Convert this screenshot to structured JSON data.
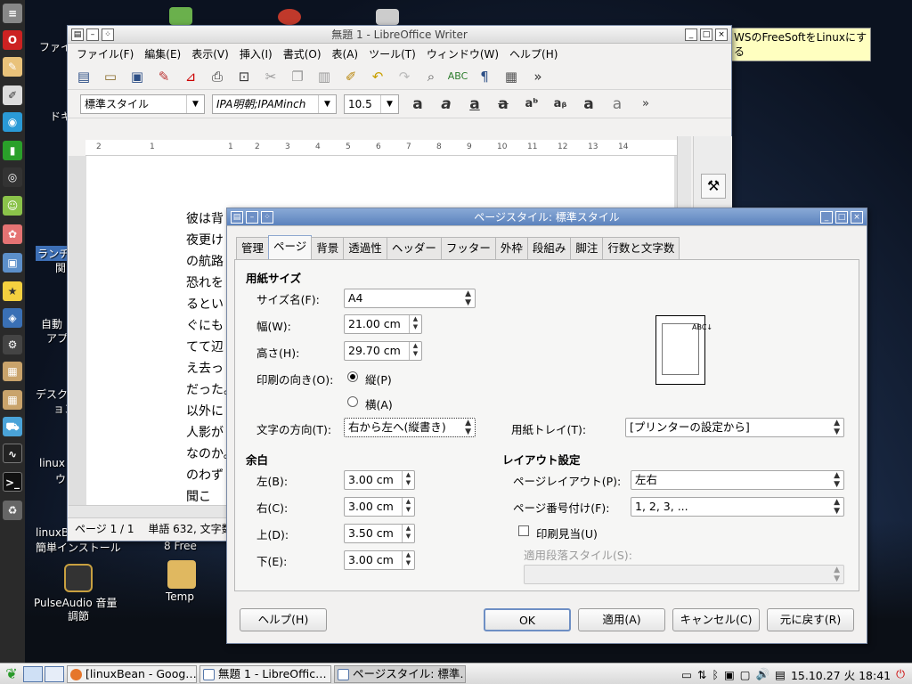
{
  "tooltip": {
    "text": "WSのFreeSoftをLinuxにする"
  },
  "desktop": {
    "labels": [
      "ファイ",
      "ドキ",
      "ランチ",
      "関",
      "自動",
      "アプ",
      "デスク",
      "ョン",
      "linux",
      "ウ",
      "linuxB",
      "簡単インストール",
      "8 Free",
      "PulseAudio 音量",
      "調節",
      "Temp"
    ]
  },
  "writer": {
    "title": "無題 1 - LibreOffice Writer",
    "menu": [
      "ファイル(F)",
      "編集(E)",
      "表示(V)",
      "挿入(I)",
      "書式(O)",
      "表(A)",
      "ツール(T)",
      "ウィンドウ(W)",
      "ヘルプ(H)"
    ],
    "paragraph_style": "標準スタイル",
    "font_name": "IPA明朝;IPAMinch",
    "font_size": "10.5",
    "ruler_ticks": [
      "2",
      "1",
      "1",
      "2",
      "3",
      "4",
      "5",
      "6",
      "7",
      "8",
      "9",
      "10",
      "11",
      "12",
      "13",
      "14"
    ],
    "doc_lines": [
      "彼は背",
      "夜更け",
      "の航路",
      "恐れを",
      "るとい",
      "ぐにも",
      "てて辺",
      "え去っ",
      "だった。",
      "以外に",
      "人影が",
      "なのか。",
      "のわず",
      "聞こ"
    ],
    "status": "ページ 1 / 1　 単語 632, 文字数"
  },
  "dialog": {
    "title": "ページスタイル: 標準スタイル",
    "tabs": [
      "管理",
      "ページ",
      "背景",
      "透過性",
      "ヘッダー",
      "フッター",
      "外枠",
      "段組み",
      "脚注",
      "行数と文字数"
    ],
    "paper_section": "用紙サイズ",
    "size_label": "サイズ名(F):",
    "size_value": "A4",
    "width_label": "幅(W):",
    "width_value": "21.00 cm",
    "height_label": "高さ(H):",
    "height_value": "29.70 cm",
    "orientation_label": "印刷の向き(O):",
    "portrait": "縦(P)",
    "landscape": "横(A)",
    "text_dir_label": "文字の方向(T):",
    "text_dir_value": "右から左へ(縦書き)",
    "tray_label": "用紙トレイ(T):",
    "tray_value": "[プリンターの設定から]",
    "preview_text": "ABC↓",
    "margin_section": "余白",
    "left_label": "左(B):",
    "left_value": "3.00 cm",
    "right_label": "右(C):",
    "right_value": "3.00 cm",
    "top_label": "上(D):",
    "top_value": "3.50 cm",
    "bottom_label": "下(E):",
    "bottom_value": "3.00 cm",
    "layout_section": "レイアウト設定",
    "page_layout_label": "ページレイアウト(P):",
    "page_layout_value": "左右",
    "page_num_label": "ページ番号付け(F):",
    "page_num_value": "1, 2, 3, ...",
    "register_label": "印刷見当(U)",
    "ref_style_label": "適用段落スタイル(S):",
    "buttons": {
      "help": "ヘルプ(H)",
      "ok": "OK",
      "apply": "適用(A)",
      "cancel": "キャンセル(C)",
      "reset": "元に戻す(R)"
    }
  },
  "taskbar": {
    "tasks": [
      "[linuxBean - Goog…",
      "無題 1 - LibreOffic…",
      "ページスタイル: 標準…"
    ],
    "clock": "15.10.27 火 18:41"
  }
}
